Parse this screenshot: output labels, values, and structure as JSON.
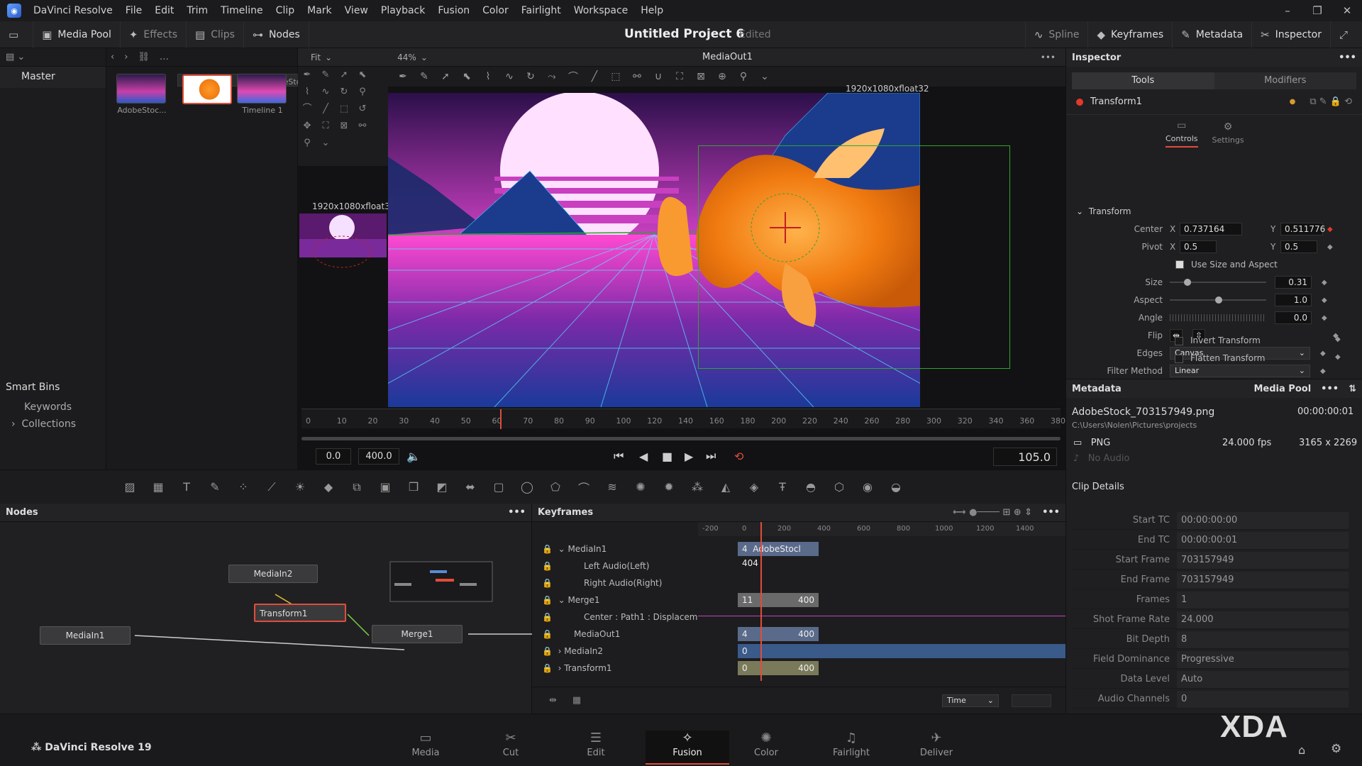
{
  "app": {
    "name": "DaVinci Resolve",
    "brand": "DaVinci Resolve 19"
  },
  "menu": [
    "File",
    "Edit",
    "Trim",
    "Timeline",
    "Clip",
    "Mark",
    "View",
    "Playback",
    "Fusion",
    "Color",
    "Fairlight",
    "Workspace",
    "Help"
  ],
  "toolbar": {
    "left": [
      "Media Pool",
      "Effects",
      "Clips",
      "Nodes"
    ],
    "right": [
      "Spline",
      "Keyframes",
      "Metadata",
      "Inspector"
    ],
    "project_title": "Untitled Project 6",
    "project_state": "Edited"
  },
  "bins": {
    "master": "Master",
    "smart_bins": "Smart Bins",
    "items": [
      "Keywords",
      "Collections"
    ]
  },
  "media_pool": {
    "clips": [
      "AdobeStoc...",
      "AdobeStoc...",
      "Timeline 1"
    ]
  },
  "viewer": {
    "name": "MediaOut1",
    "fit": "Fit",
    "zoom": "44%",
    "resolution": "1920x1080xfloat32",
    "mini_resolution": "1920x1080xfloat32",
    "ruler_ticks": [
      "0",
      "10",
      "20",
      "30",
      "40",
      "50",
      "60",
      "70",
      "80",
      "90",
      "100",
      "120",
      "140",
      "160",
      "180",
      "200",
      "220",
      "240",
      "260",
      "280",
      "300",
      "320",
      "340",
      "360",
      "380"
    ],
    "render_start": "0.0",
    "render_end": "400.0",
    "current_time": "105.0"
  },
  "inspector": {
    "title": "Inspector",
    "tabs": [
      "Tools",
      "Modifiers"
    ],
    "tool": "Transform1",
    "subtabs": [
      "Controls",
      "Settings"
    ],
    "section": "Transform",
    "center": {
      "label": "Center",
      "x": "0.737164",
      "y": "0.511776"
    },
    "pivot": {
      "label": "Pivot",
      "x": "0.5",
      "y": "0.5"
    },
    "use_size_aspect": "Use Size and Aspect",
    "size": {
      "label": "Size",
      "value": "0.31"
    },
    "aspect": {
      "label": "Aspect",
      "value": "1.0"
    },
    "angle": {
      "label": "Angle",
      "value": "0.0"
    },
    "flip": "Flip",
    "edges": {
      "label": "Edges",
      "value": "Canvas"
    },
    "filter": {
      "label": "Filter Method",
      "value": "Linear"
    },
    "invert": "Invert Transform",
    "flatten": "Flatten Transform",
    "xlabel": "X",
    "ylabel": "Y"
  },
  "metadata": {
    "title": "Metadata",
    "pool": "Media Pool",
    "filename": "AdobeStock_703157949.png",
    "duration": "00:00:00:01",
    "path": "C:\\Users\\Nolen\\Pictures\\projects",
    "format": "PNG",
    "fps": "24.000 fps",
    "dims": "3165 x 2269",
    "audio": "No Audio",
    "clip_details": "Clip Details",
    "rows": [
      {
        "label": "Start TC",
        "value": "00:00:00:00"
      },
      {
        "label": "End TC",
        "value": "00:00:00:01"
      },
      {
        "label": "Start Frame",
        "value": "703157949"
      },
      {
        "label": "End Frame",
        "value": "703157949"
      },
      {
        "label": "Frames",
        "value": "1"
      },
      {
        "label": "Shot Frame Rate",
        "value": "24.000"
      },
      {
        "label": "Bit Depth",
        "value": "8"
      },
      {
        "label": "Field Dominance",
        "value": "Progressive"
      },
      {
        "label": "Data Level",
        "value": "Auto"
      },
      {
        "label": "Audio Channels",
        "value": "0"
      }
    ]
  },
  "nodes": {
    "title": "Nodes",
    "items": [
      "MediaIn2",
      "Transform1",
      "MediaIn1",
      "Merge1"
    ]
  },
  "keyframes": {
    "title": "Keyframes",
    "ruler": [
      "-200",
      "0",
      "200",
      "400",
      "600",
      "800",
      "1000",
      "1200",
      "1400"
    ],
    "rows": [
      "MediaIn1",
      "Left Audio(Left)",
      "Right Audio(Right)",
      "Merge1",
      "Center : Path1 : Displacem",
      "MediaOut1",
      "MediaIn2",
      "Transform1"
    ],
    "bars": [
      {
        "start": "4",
        "label": "AdobeStocl 404"
      },
      {
        "start": "11",
        "end": "400"
      },
      {
        "start": "4",
        "end": "400"
      },
      {
        "start": "0"
      },
      {
        "start": "0",
        "end": "400"
      }
    ],
    "time_mode": "Time"
  },
  "pages": [
    "Media",
    "Cut",
    "Edit",
    "Fusion",
    "Color",
    "Fairlight",
    "Deliver"
  ],
  "active_page": "Fusion",
  "watermark": "XDA"
}
